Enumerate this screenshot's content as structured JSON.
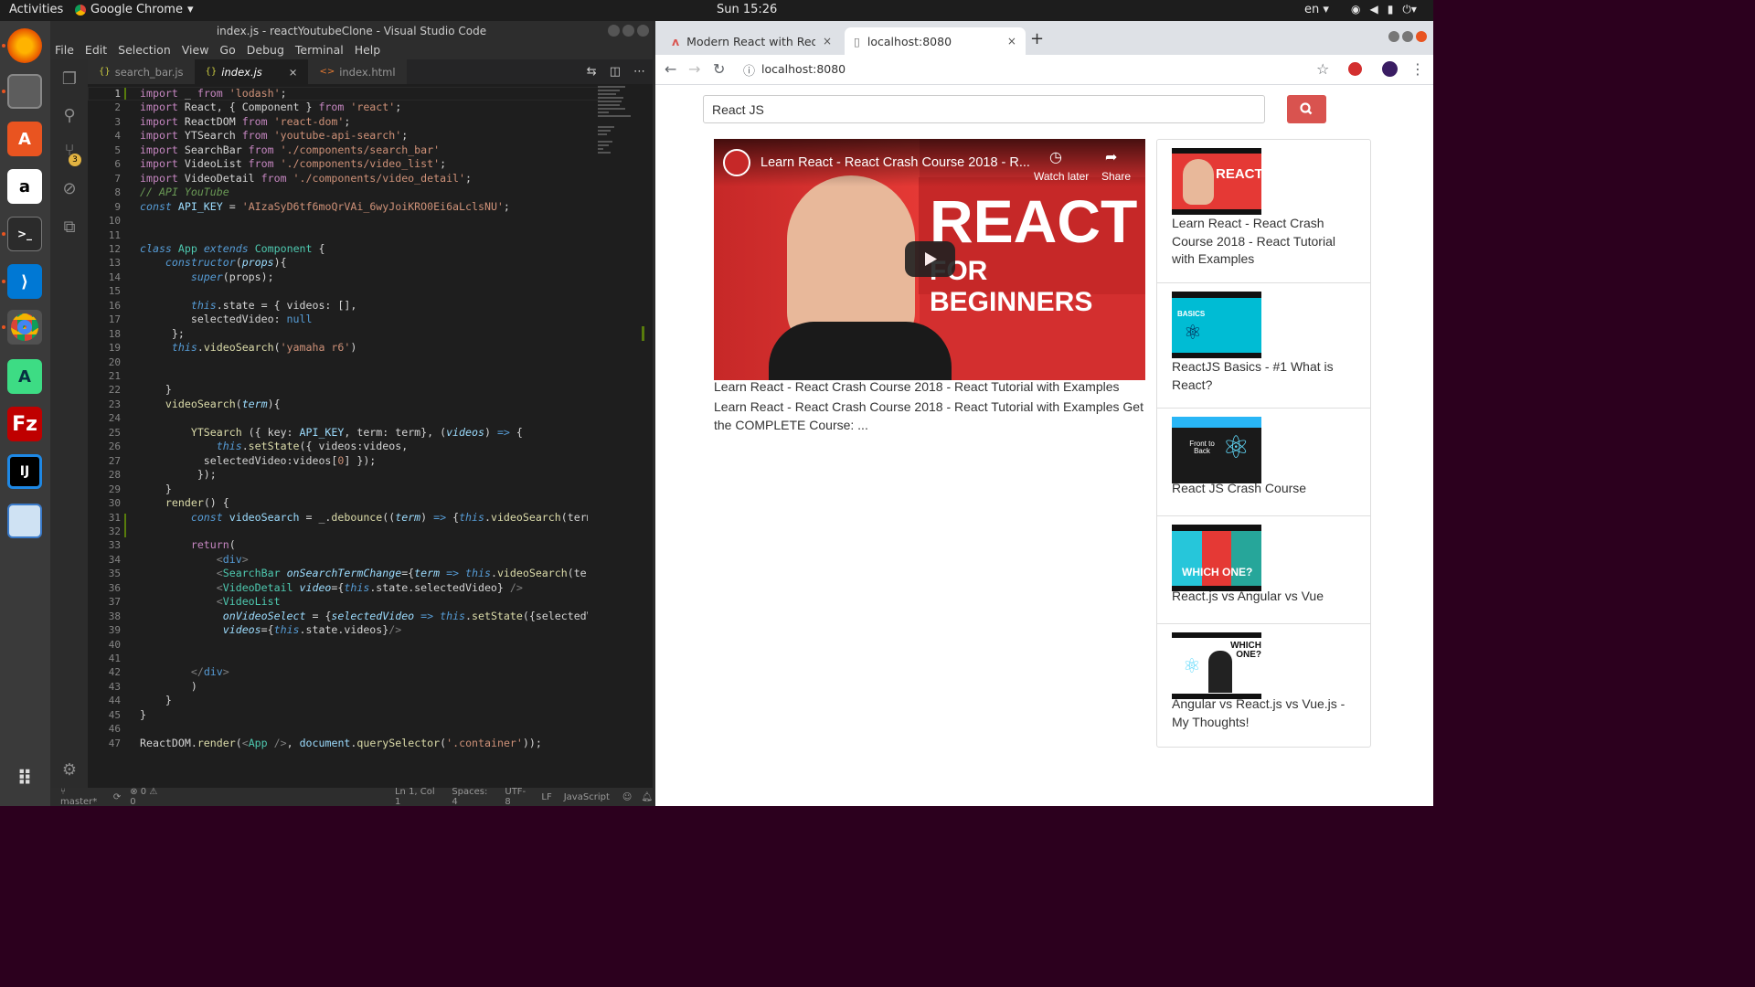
{
  "topbar": {
    "activities": "Activities",
    "app": "Google Chrome",
    "clock": "Sun 15:26",
    "lang": "en"
  },
  "dock": {
    "items": [
      "firefox-icon",
      "files-icon",
      "software-center-icon",
      "amazon-icon",
      "terminal-icon",
      "vscode-icon",
      "chrome-icon",
      "android-studio-icon",
      "filezilla-icon",
      "intellij-icon",
      "virtualbox-icon",
      "apps-grid-icon"
    ]
  },
  "vscode": {
    "title": "index.js - reactYoutubeClone - Visual Studio Code",
    "menu": [
      "File",
      "Edit",
      "Selection",
      "View",
      "Go",
      "Debug",
      "Terminal",
      "Help"
    ],
    "tabs": [
      {
        "label": "search_bar.js",
        "icon": "{}"
      },
      {
        "label": "index.js",
        "icon": "{}",
        "close": "×"
      },
      {
        "label": "index.html",
        "icon": "<>"
      }
    ],
    "scm_badge": "3",
    "status": {
      "branch": "master*",
      "errors": "0",
      "warnings": "0",
      "position": "Ln 1, Col 1",
      "spaces": "Spaces: 4",
      "encoding": "UTF-8",
      "eol": "LF",
      "language": "JavaScript"
    }
  },
  "chrome": {
    "tabs": [
      {
        "label": "Modern React with Redux",
        "close": "×"
      },
      {
        "label": "localhost:8080",
        "close": "×"
      }
    ],
    "new_tab": "+",
    "url": "localhost:8080"
  },
  "app": {
    "search_value": "React JS",
    "player": {
      "title": "Learn React - React Crash Course 2018 - R...",
      "watch_later": "Watch later",
      "share": "Share",
      "thumb_big": "REACT",
      "thumb_sub": "FOR BEGINNERS"
    },
    "video_title": "Learn React - React Crash Course 2018 - React Tutorial with Examples",
    "video_desc": "Learn React - React Crash Course 2018 - React Tutorial with Examples Get the COMPLETE Course: ...",
    "list": [
      {
        "label": "Learn React - React Crash Course 2018 - React Tutorial with Examples",
        "thumb_text": "REACT"
      },
      {
        "label": "ReactJS Basics - #1 What is React?",
        "thumb_text": "BASICS"
      },
      {
        "label": "React JS Crash Course",
        "thumb_text": "Front to Back"
      },
      {
        "label": "React.js vs Angular vs Vue",
        "thumb_text": "WHICH ONE?"
      },
      {
        "label": "Angular vs React.js vs Vue.js - My Thoughts!",
        "thumb_text": "WHICH ONE?"
      }
    ]
  }
}
